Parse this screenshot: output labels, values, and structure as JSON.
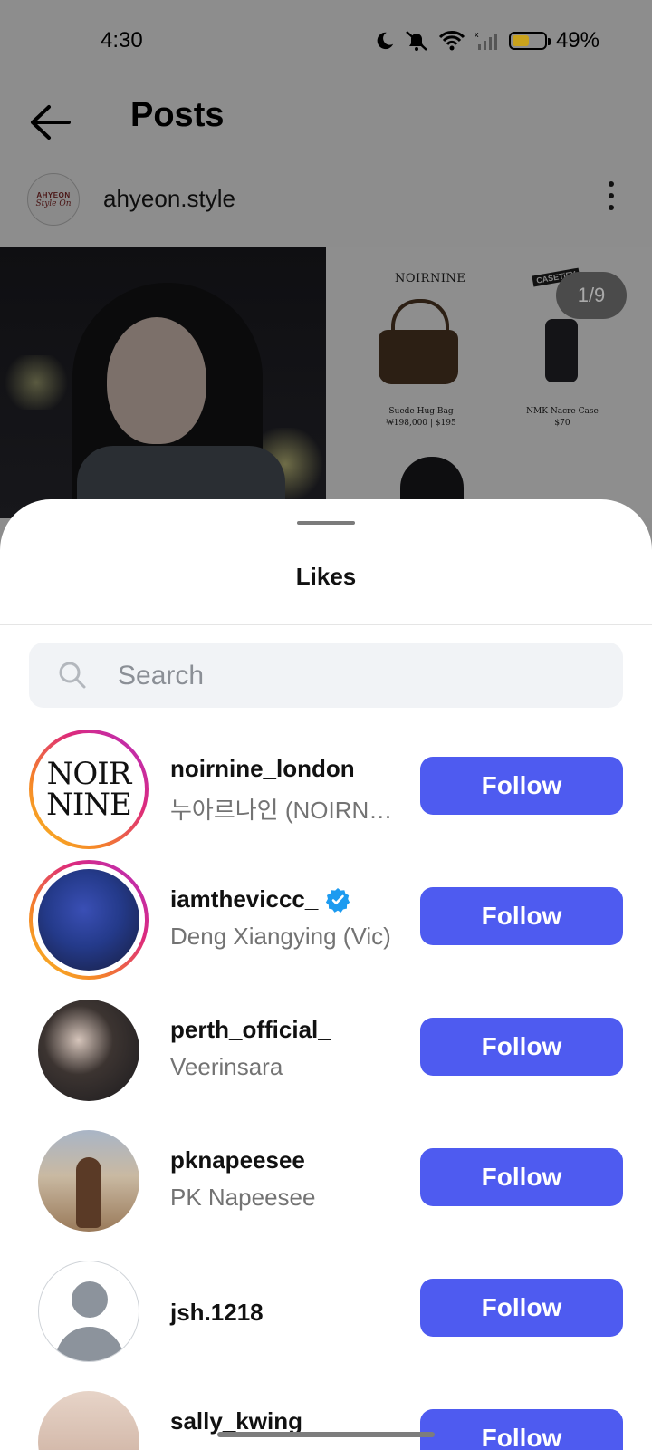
{
  "status_bar": {
    "time": "4:30",
    "battery": "49%"
  },
  "header": {
    "title": "Posts"
  },
  "post": {
    "author": "ahyeon.style",
    "avatar_text_top": "AHYEON",
    "avatar_text_bottom": "Style On",
    "image_counter": "1/9",
    "products": {
      "brand": "NOIRNINE",
      "case_brand": "CASETiFY",
      "item1_name": "Suede Hug Bag",
      "item1_price": "₩198,000 | $195",
      "item2_name": "NMK Nacre Case",
      "item2_price": "$70"
    }
  },
  "likes": {
    "title": "Likes",
    "search_placeholder": "Search",
    "users": [
      {
        "username": "noirnine_london",
        "full_name": "누아르나인 (NOIRNINE)",
        "button": "Follow",
        "avatar_text_1": "NOIR",
        "avatar_text_2": "NINE"
      },
      {
        "username": "iamtheviccc_",
        "full_name": "Deng Xiangying (Vic)",
        "button": "Follow",
        "verified": true
      },
      {
        "username": "perth_official_",
        "full_name": "Veerinsara",
        "button": "Follow"
      },
      {
        "username": "pknapeesee",
        "full_name": "PK Napeesee",
        "button": "Follow"
      },
      {
        "username": "jsh.1218",
        "full_name": "",
        "button": "Follow"
      },
      {
        "username": "sally_kwing",
        "full_name": "",
        "button": "Follow"
      }
    ]
  },
  "colors": {
    "follow_button": "#4e5bf0",
    "verified": "#1d9bf0"
  }
}
